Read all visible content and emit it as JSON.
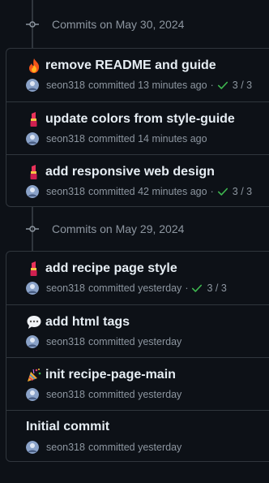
{
  "groups": [
    {
      "title": "Commits on May 30, 2024",
      "commits": [
        {
          "emoji": "fire",
          "message": "remove README and guide",
          "author": "seon318",
          "verb": "committed",
          "time": "13 minutes ago",
          "checks": "3 / 3"
        },
        {
          "emoji": "lipstick",
          "message": "update colors from style-guide",
          "author": "seon318",
          "verb": "committed",
          "time": "14 minutes ago",
          "checks": ""
        },
        {
          "emoji": "lipstick",
          "message": "add responsive web design",
          "author": "seon318",
          "verb": "committed",
          "time": "42 minutes ago",
          "checks": "3 / 3"
        }
      ]
    },
    {
      "title": "Commits on May 29, 2024",
      "commits": [
        {
          "emoji": "lipstick",
          "message": "add recipe page style",
          "author": "seon318",
          "verb": "committed",
          "time": "yesterday",
          "checks": "3 / 3"
        },
        {
          "emoji": "speech-balloon",
          "message": "add html tags",
          "author": "seon318",
          "verb": "committed",
          "time": "yesterday",
          "checks": ""
        },
        {
          "emoji": "party-popper",
          "message": "init recipe-page-main",
          "author": "seon318",
          "verb": "committed",
          "time": "yesterday",
          "checks": ""
        },
        {
          "emoji": "",
          "message": "Initial commit",
          "author": "seon318",
          "verb": "committed",
          "time": "yesterday",
          "checks": ""
        }
      ]
    }
  ],
  "colors": {
    "background": "#0d1117",
    "border": "#30363d",
    "text_primary": "#e6edf3",
    "text_muted": "#8d96a0",
    "success": "#3fb950"
  }
}
